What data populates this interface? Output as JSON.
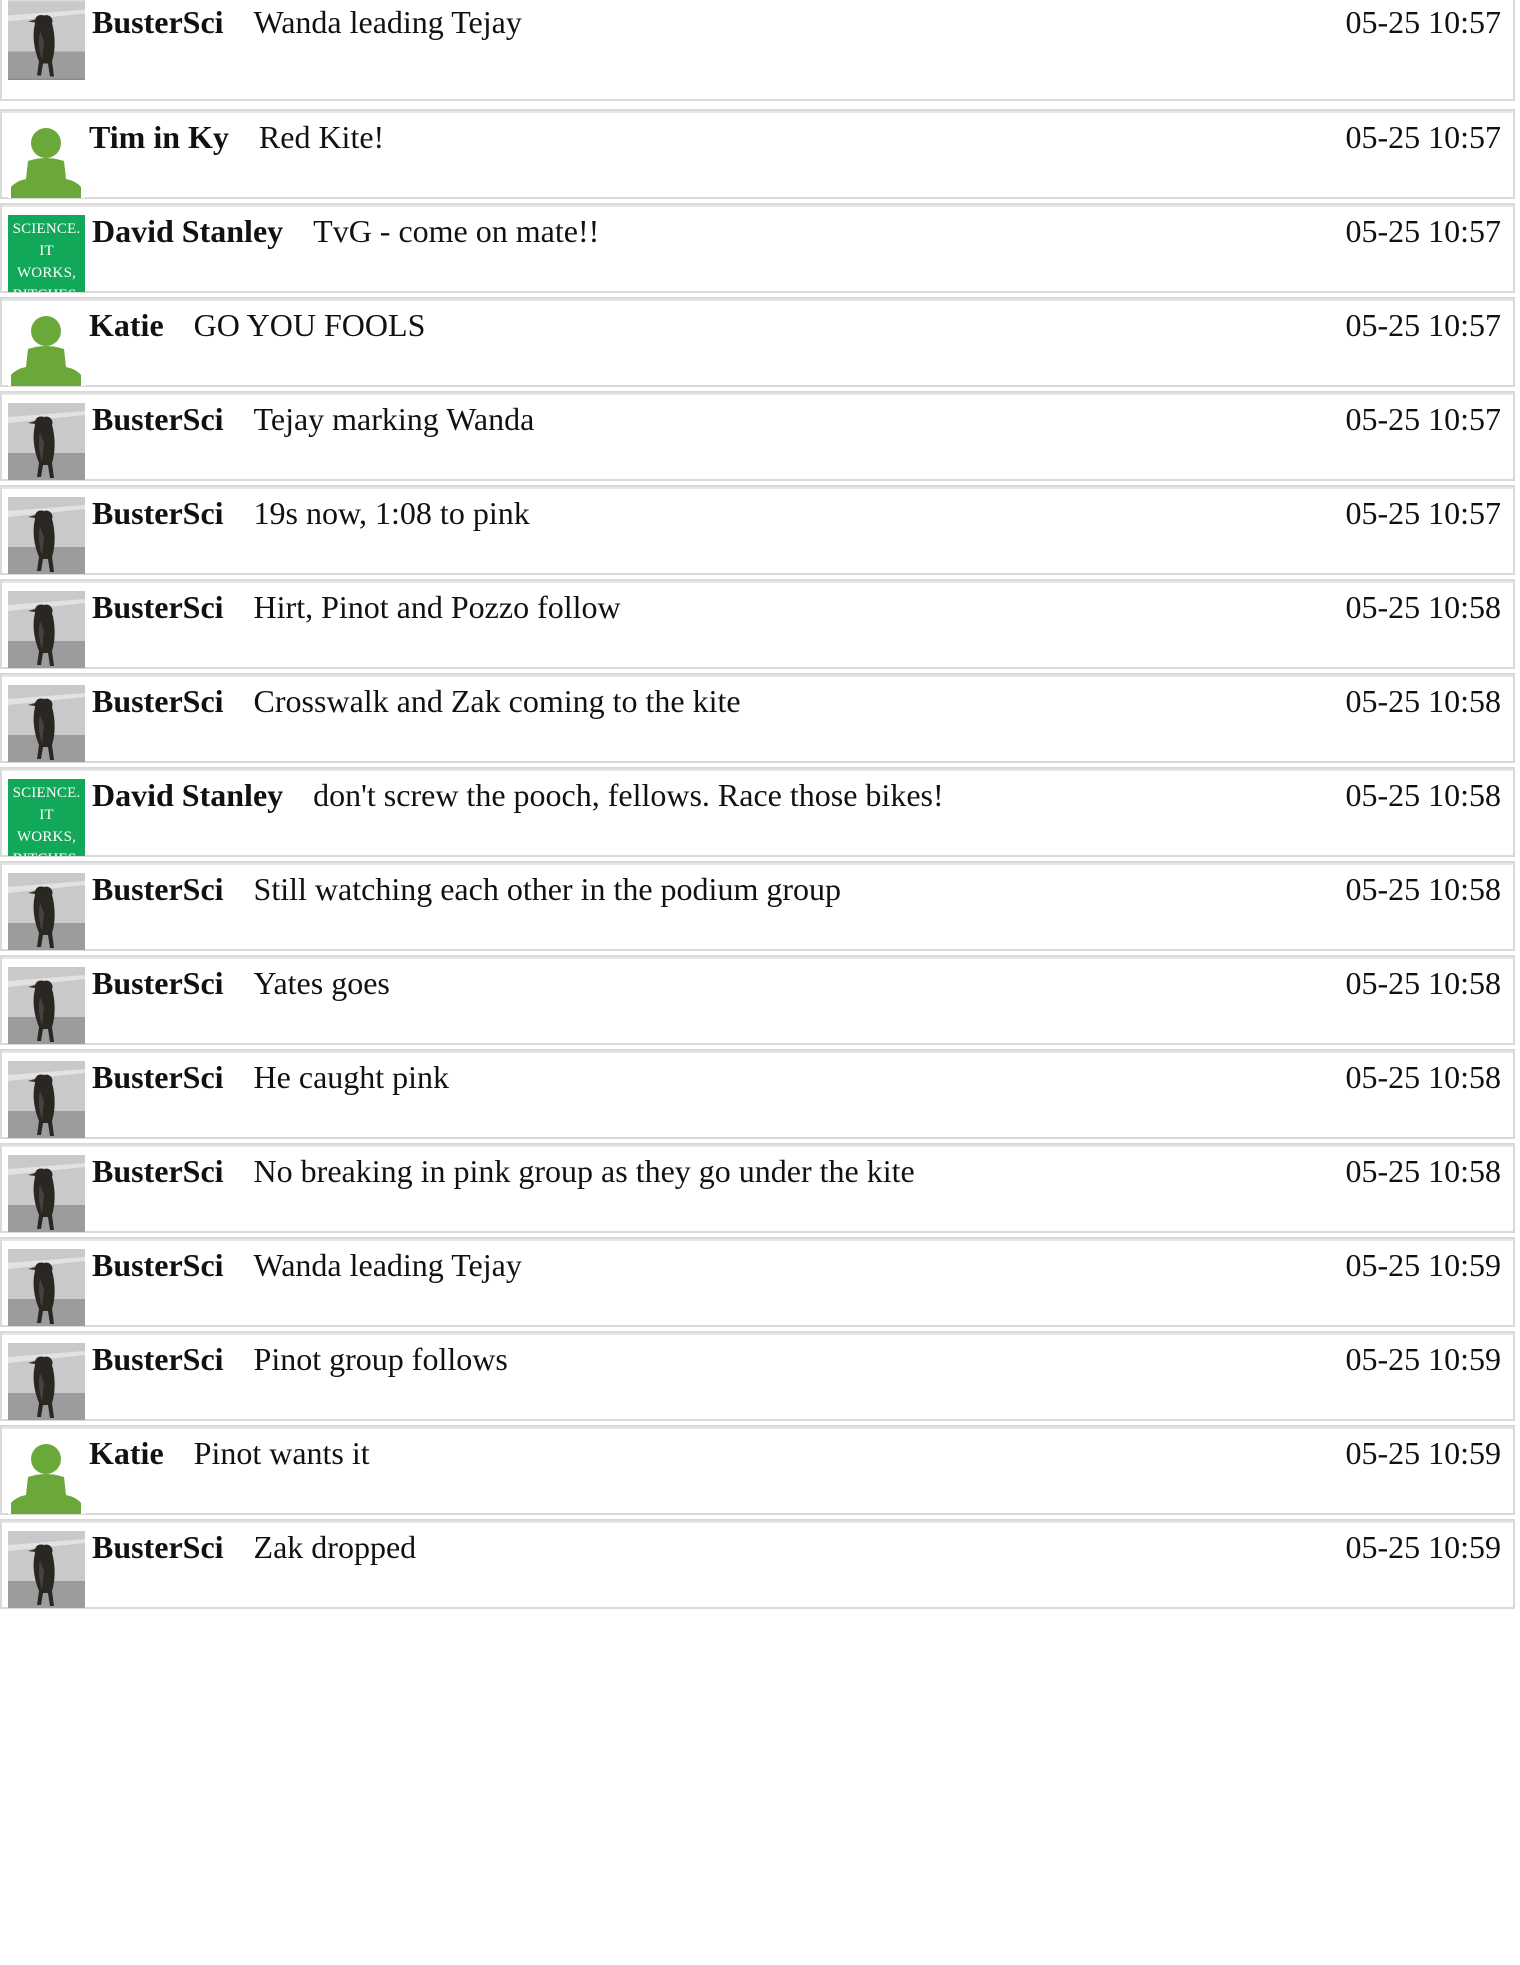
{
  "colors": {
    "person_icon": "#6aa83a",
    "science_badge": "#12a85a",
    "border": "#d9d9d9"
  },
  "avatars": {
    "science_badge_lines": [
      "SCIENCE.",
      "IT WORKS,",
      "BITCHES."
    ]
  },
  "messages": [
    {
      "user": "BusterSci",
      "avatar": "penguin-photo",
      "text": "Wanda leading Tejay",
      "time": "05-25 10:57"
    },
    {
      "user": "Tim in Ky",
      "avatar": "person-icon",
      "text": "Red Kite!",
      "time": "05-25 10:57"
    },
    {
      "user": "David Stanley",
      "avatar": "science-badge",
      "text": "TvG - come on mate!!",
      "time": "05-25 10:57"
    },
    {
      "user": "Katie",
      "avatar": "person-icon",
      "text": "GO YOU FOOLS",
      "time": "05-25 10:57"
    },
    {
      "user": "BusterSci",
      "avatar": "penguin-photo",
      "text": "Tejay marking Wanda",
      "time": "05-25 10:57"
    },
    {
      "user": "BusterSci",
      "avatar": "penguin-photo",
      "text": "19s now, 1:08 to pink",
      "time": "05-25 10:57"
    },
    {
      "user": "BusterSci",
      "avatar": "penguin-photo",
      "text": "Hirt, Pinot and Pozzo follow",
      "time": "05-25 10:58"
    },
    {
      "user": "BusterSci",
      "avatar": "penguin-photo",
      "text": "Crosswalk and Zak coming to the kite",
      "time": "05-25 10:58"
    },
    {
      "user": "David Stanley",
      "avatar": "science-badge",
      "text": "don't screw the pooch, fellows. Race those bikes!",
      "time": "05-25 10:58"
    },
    {
      "user": "BusterSci",
      "avatar": "penguin-photo",
      "text": "Still watching each other in the podium group",
      "time": "05-25 10:58"
    },
    {
      "user": "BusterSci",
      "avatar": "penguin-photo",
      "text": "Yates goes",
      "time": "05-25 10:58"
    },
    {
      "user": "BusterSci",
      "avatar": "penguin-photo",
      "text": "He caught pink",
      "time": "05-25 10:58"
    },
    {
      "user": "BusterSci",
      "avatar": "penguin-photo",
      "text": "No breaking in pink group as they go under the kite",
      "time": "05-25 10:58"
    },
    {
      "user": "BusterSci",
      "avatar": "penguin-photo",
      "text": "Wanda leading Tejay",
      "time": "05-25 10:59"
    },
    {
      "user": "BusterSci",
      "avatar": "penguin-photo",
      "text": "Pinot group follows",
      "time": "05-25 10:59"
    },
    {
      "user": "Katie",
      "avatar": "person-icon",
      "text": "Pinot wants it",
      "time": "05-25 10:59"
    },
    {
      "user": "BusterSci",
      "avatar": "penguin-photo",
      "text": "Zak dropped",
      "time": "05-25 10:59"
    }
  ]
}
